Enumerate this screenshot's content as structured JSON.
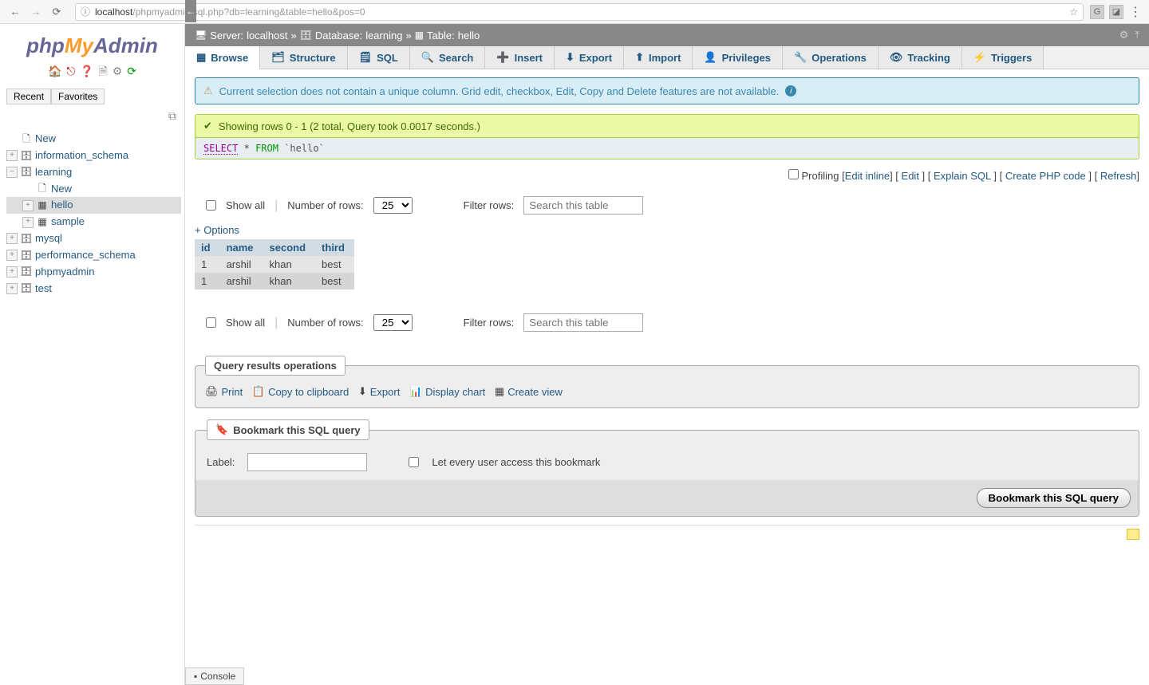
{
  "browser": {
    "url_host": "localhost",
    "url_path": "/phpmyadmin/sql.php?db=learning&table=hello&pos=0",
    "star": "☆",
    "ext_g": "G"
  },
  "logo": {
    "php": "php",
    "my": "My",
    "admin": "Admin"
  },
  "sidebar": {
    "recent": "Recent",
    "favorites": "Favorites",
    "tree": {
      "new": "New",
      "info_schema": "information_schema",
      "learning": "learning",
      "learning_new": "New",
      "hello": "hello",
      "sample": "sample",
      "mysql": "mysql",
      "perf_schema": "performance_schema",
      "phpmyadmin": "phpmyadmin",
      "test": "test"
    }
  },
  "crumbs": {
    "server_lbl": "Server:",
    "server_val": "localhost",
    "db_lbl": "Database:",
    "db_val": "learning",
    "table_lbl": "Table:",
    "table_val": "hello",
    "sep": "»"
  },
  "tabs": {
    "browse": "Browse",
    "structure": "Structure",
    "sql": "SQL",
    "search": "Search",
    "insert": "Insert",
    "export": "Export",
    "import": "Import",
    "privileges": "Privileges",
    "operations": "Operations",
    "tracking": "Tracking",
    "triggers": "Triggers"
  },
  "notice": "Current selection does not contain a unique column. Grid edit, checkbox, Edit, Copy and Delete features are not available.",
  "success_msg": "Showing rows 0 - 1 (2 total, Query took 0.0017 seconds.)",
  "sql": {
    "select": "SELECT",
    "star": "*",
    "from": "FROM",
    "table": "`hello`"
  },
  "sql_actions": {
    "profiling": "Profiling",
    "edit_inline": "Edit inline",
    "edit": "Edit",
    "explain": "Explain SQL",
    "create_php": "Create PHP code",
    "refresh": "Refresh"
  },
  "table_ctrl": {
    "show_all": "Show all",
    "num_rows_lbl": "Number of rows:",
    "num_rows_val": "25",
    "filter_lbl": "Filter rows:",
    "filter_placeholder": "Search this table"
  },
  "options_link": "+ Options",
  "table": {
    "headers": {
      "id": "id",
      "name": "name",
      "second": "second",
      "third": "third"
    },
    "rows": [
      {
        "id": "1",
        "name": "arshil",
        "second": "khan",
        "third": "best"
      },
      {
        "id": "1",
        "name": "arshil",
        "second": "khan",
        "third": "best"
      }
    ]
  },
  "ops_legend": "Query results operations",
  "ops": {
    "print": "Print",
    "copy": "Copy to clipboard",
    "export": "Export",
    "chart": "Display chart",
    "view": "Create view"
  },
  "bookmark": {
    "legend": "Bookmark this SQL query",
    "label": "Label:",
    "share": "Let every user access this bookmark",
    "submit": "Bookmark this SQL query"
  },
  "console": "Console"
}
